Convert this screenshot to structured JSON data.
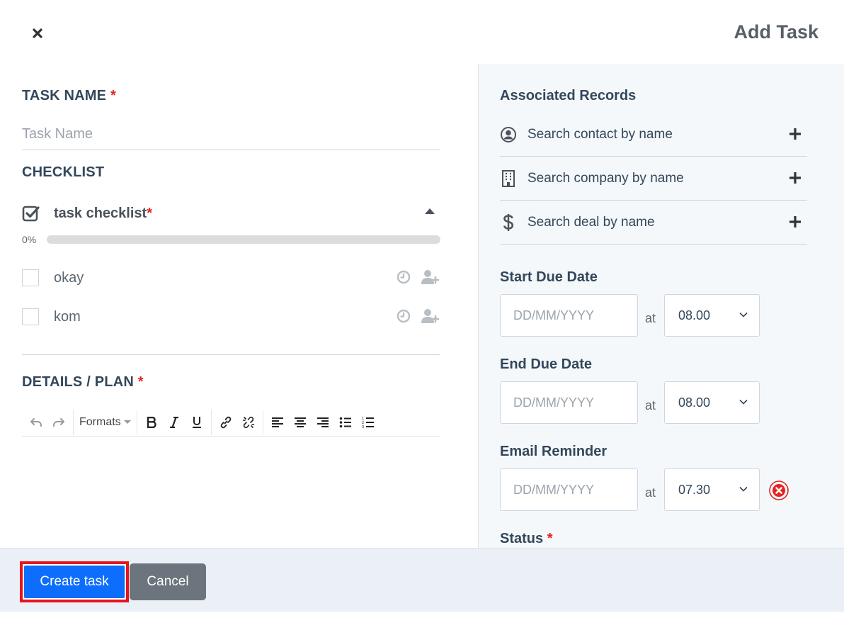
{
  "header": {
    "title": "Add Task",
    "close_icon": "close-icon"
  },
  "task_name": {
    "label": "TASK NAME",
    "required_mark": "*",
    "placeholder": "Task Name",
    "value": ""
  },
  "checklist": {
    "label": "CHECKLIST",
    "title": "task checklist",
    "required_mark": "*",
    "progress_text": "0%",
    "progress_fraction": 0,
    "accent_color": "#0d6efd",
    "items": [
      {
        "label": "okay",
        "checked": false
      },
      {
        "label": "kom",
        "checked": false
      }
    ]
  },
  "details": {
    "label": "DETAILS / PLAN",
    "required_mark": "*",
    "toolbar": {
      "formats_label": "Formats"
    }
  },
  "associated": {
    "title": "Associated Records",
    "rows": [
      {
        "label": "Search contact by name",
        "icon": "contact-icon"
      },
      {
        "label": "Search company by name",
        "icon": "building-icon"
      },
      {
        "label": "Search deal by name",
        "icon": "dollar-icon"
      }
    ]
  },
  "dates": {
    "at_label": "at",
    "start": {
      "label": "Start Due Date",
      "placeholder": "DD/MM/YYYY",
      "time": "08.00"
    },
    "end": {
      "label": "End Due Date",
      "placeholder": "DD/MM/YYYY",
      "time": "08.00"
    },
    "reminder": {
      "label": "Email Reminder",
      "placeholder": "DD/MM/YYYY",
      "time": "07.30"
    }
  },
  "status": {
    "label": "Status",
    "required_mark": "*"
  },
  "footer": {
    "create_label": "Create task",
    "cancel_label": "Cancel",
    "highlight_color": "#e8141b"
  }
}
